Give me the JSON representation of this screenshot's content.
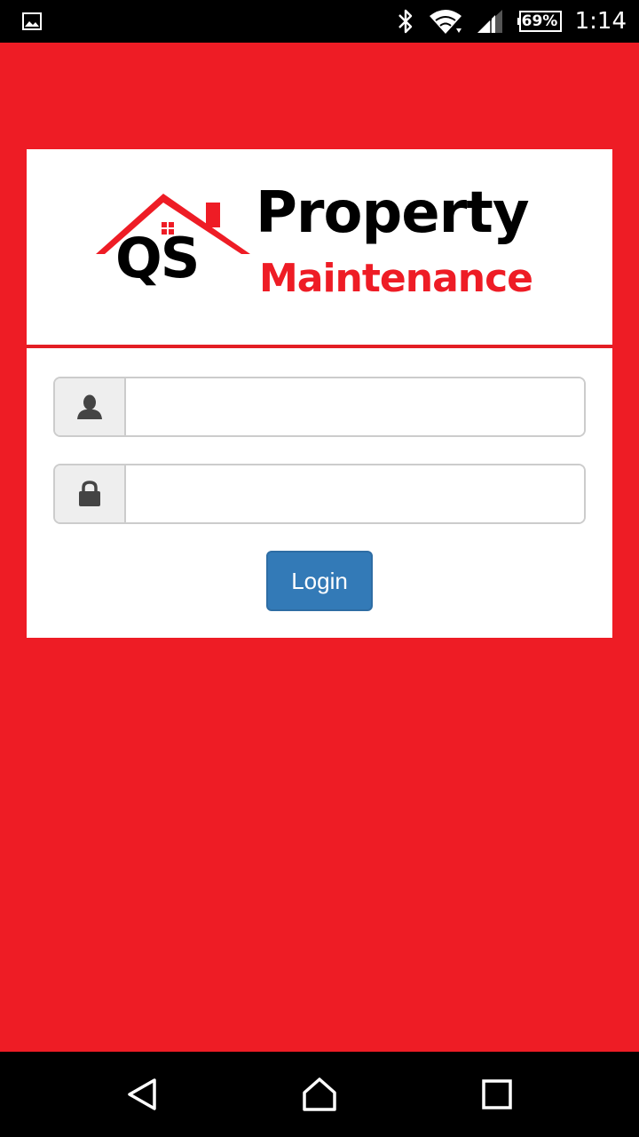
{
  "status_bar": {
    "battery": "69%",
    "time": "1:14"
  },
  "logo": {
    "initials": "QS",
    "line1": "Property",
    "line2": "Maintenance"
  },
  "form": {
    "username": {
      "value": "",
      "placeholder": "",
      "icon": "user-icon"
    },
    "password": {
      "value": "",
      "placeholder": "",
      "icon": "lock-icon"
    },
    "login_label": "Login"
  },
  "colors": {
    "background": "#ee1c25",
    "primary_button": "#337ab7",
    "status_bar": "#000000"
  }
}
